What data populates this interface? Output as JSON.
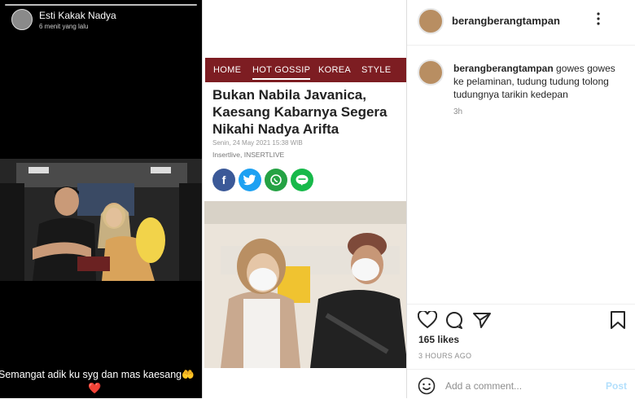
{
  "story": {
    "user_name": "Esti Kakak Nadya",
    "time_ago": "6 menit yang lalu",
    "caption": "Semangat adik ku syg dan mas kaesang🤲",
    "heart": "❤️"
  },
  "news": {
    "nav": [
      "HOME",
      "HOT GOSSIP",
      "KOREA",
      "STYLE"
    ],
    "nav_active": "HOT GOSSIP",
    "nav_color": "#7d1d22",
    "headline": "Bukan Nabila Javanica, Kaesang Kabarnya Segera Nikahi Nadya Arifta",
    "date": "Senin, 24 May 2021 15:38 WIB",
    "source": "Insertlive, INSERTLIVE",
    "share_icons": [
      "facebook-icon",
      "twitter-icon",
      "whatsapp-icon",
      "line-icon"
    ]
  },
  "instagram": {
    "username": "berangberangtampan",
    "comment_user": "berangberangtampan",
    "comment_text": "gowes gowes ke pelaminan, tudung tudung tolong tudungnya tarikin kedepan",
    "comment_time": "3h",
    "likes": "165 likes",
    "posted_ago": "3 HOURS AGO",
    "add_comment_placeholder": "Add a comment...",
    "post_label": "Post"
  }
}
